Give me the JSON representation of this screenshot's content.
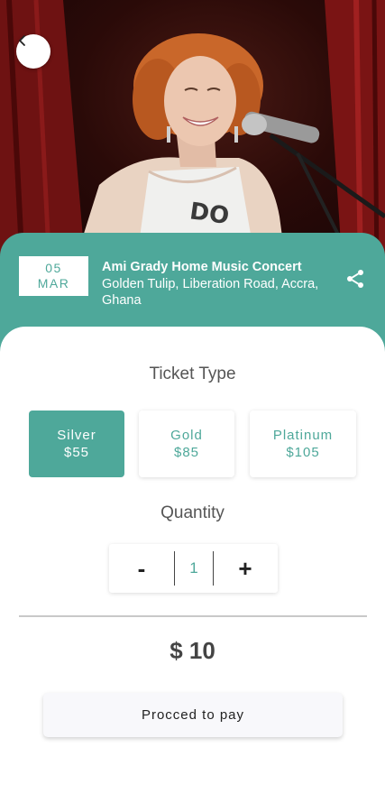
{
  "event": {
    "day": "05",
    "month": "MAR",
    "title": "Ami Grady Home Music Concert",
    "location": "Golden Tulip, Liberation Road, Accra, Ghana"
  },
  "ticket_section": {
    "title": "Ticket Type",
    "options": [
      {
        "name": "Silver",
        "price": "$55",
        "selected": true
      },
      {
        "name": "Gold",
        "price": "$85",
        "selected": false
      },
      {
        "name": "Platinum",
        "price": "$105",
        "selected": false
      }
    ]
  },
  "quantity_section": {
    "title": "Quantity",
    "minus_label": "-",
    "plus_label": "+",
    "value": "1"
  },
  "total": "$ 10",
  "pay_button_label": "Procced to pay",
  "icons": {
    "back": "chevron-left-icon",
    "share": "share-icon"
  },
  "colors": {
    "accent": "#4ea89a",
    "text_dark": "#444444"
  }
}
